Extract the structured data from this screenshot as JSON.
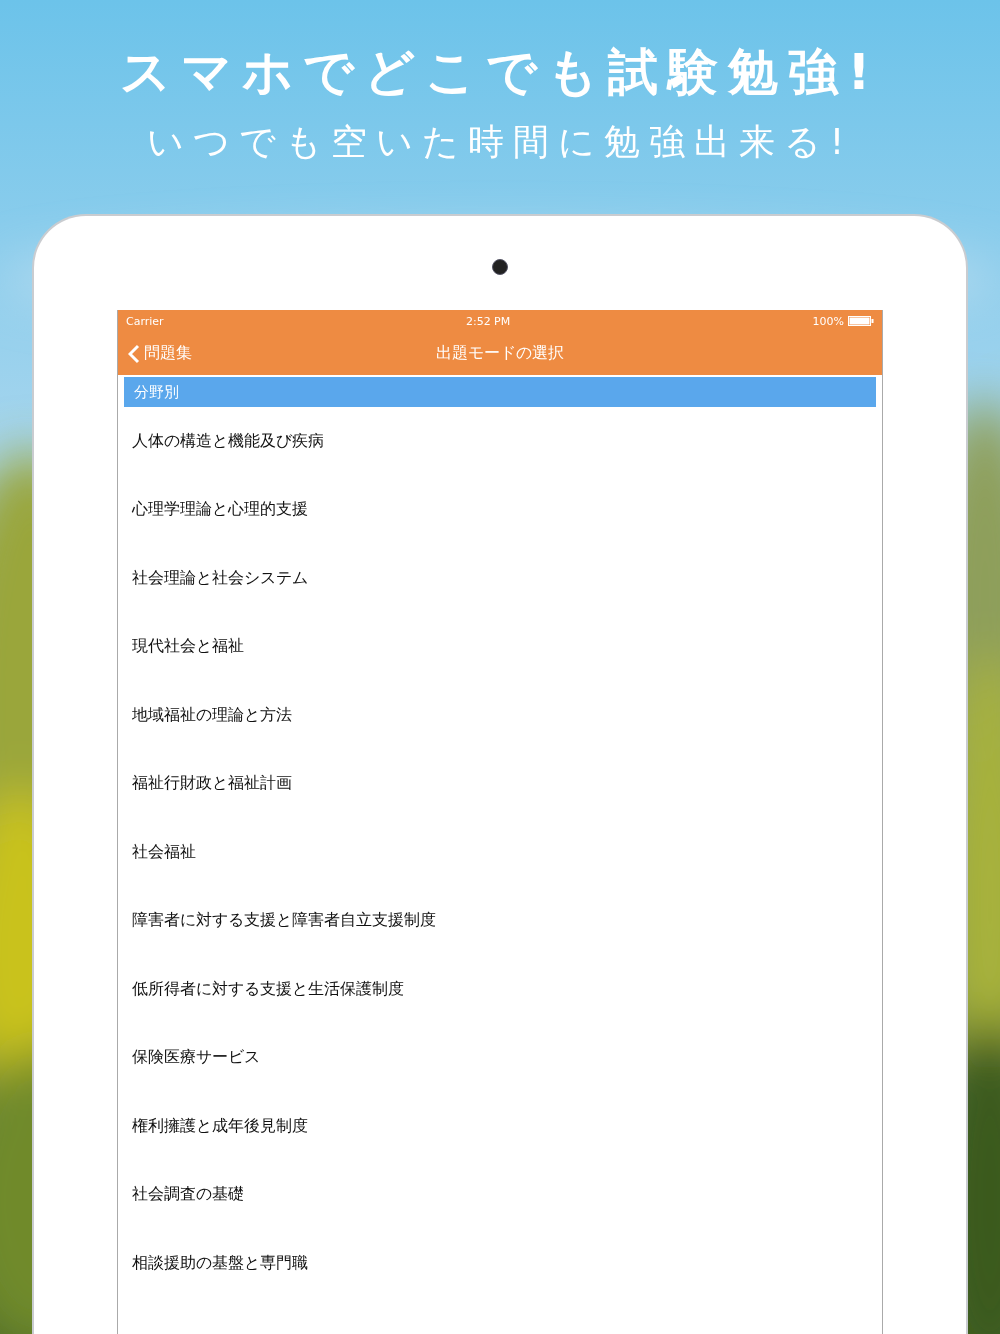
{
  "headline": "スマホでどこでも試験勉強!",
  "subheadline": "いつでも空いた時間に勉強出来る!",
  "status_bar": {
    "carrier": "Carrier",
    "time": "2:52 PM",
    "battery": "100%"
  },
  "nav_bar": {
    "back": "問題集",
    "title": "出題モードの選択"
  },
  "section": {
    "title": "分野別"
  },
  "items": [
    {
      "label": "人体の構造と機能及び疾病"
    },
    {
      "label": "心理学理論と心理的支援"
    },
    {
      "label": "社会理論と社会システム"
    },
    {
      "label": "現代社会と福祉"
    },
    {
      "label": "地域福祉の理論と方法"
    },
    {
      "label": "福祉行財政と福祉計画"
    },
    {
      "label": "社会福祉"
    },
    {
      "label": "障害者に対する支援と障害者自立支援制度"
    },
    {
      "label": "低所得者に対する支援と生活保護制度"
    },
    {
      "label": "保険医療サービス"
    },
    {
      "label": "権利擁護と成年後見制度"
    },
    {
      "label": "社会調査の基礎"
    },
    {
      "label": "相談援助の基盤と専門職"
    }
  ]
}
